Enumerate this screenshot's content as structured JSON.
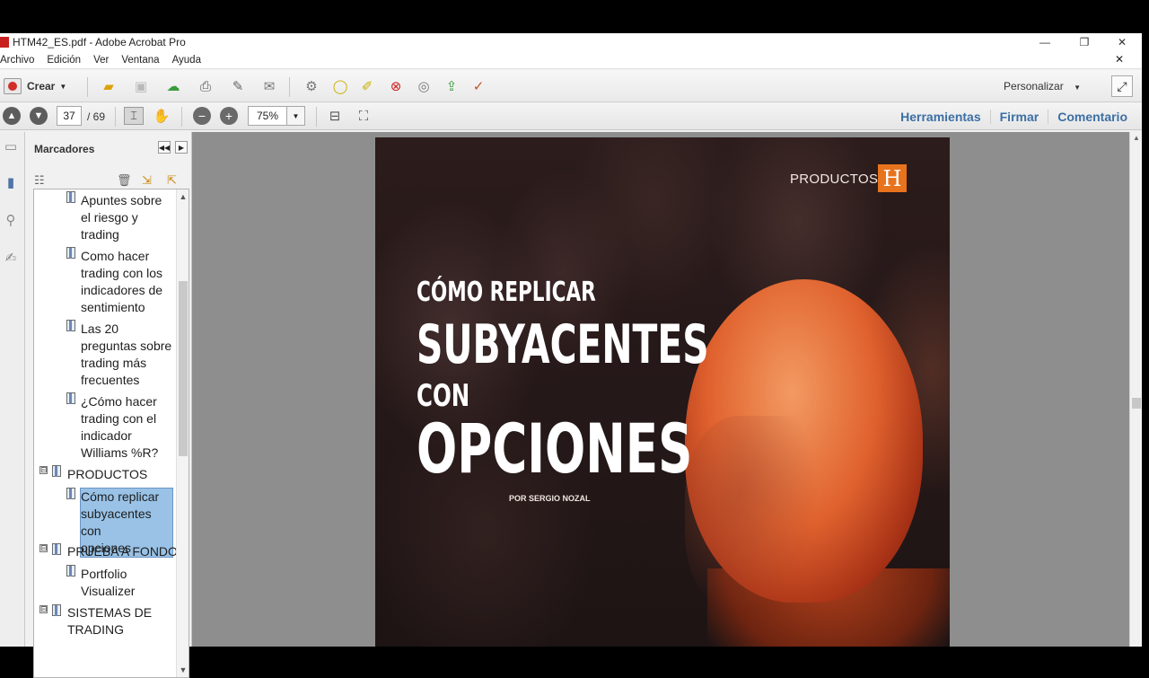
{
  "window": {
    "title": "HTM42_ES.pdf - Adobe Acrobat Pro",
    "minimize": "—",
    "restore": "❐",
    "close": "✕"
  },
  "menu": {
    "items": [
      "Archivo",
      "Edición",
      "Ver",
      "Ventana",
      "Ayuda"
    ],
    "close_doc": "✕"
  },
  "toolbar": {
    "create_label": "Crear",
    "caret": "▼",
    "customize_label": "Personalizar",
    "icons": [
      "open-folder-icon",
      "save-icon",
      "cloud-upload-icon",
      "print-icon",
      "edit-icon",
      "email-icon",
      "settings-icon",
      "comment-icon",
      "highlight-icon",
      "delete-pdf-icon",
      "security-icon",
      "export-icon",
      "form-icon"
    ],
    "expand_icon": "⤢"
  },
  "nav": {
    "prev_icon": "▲",
    "next_icon": "▼",
    "current_page": "37",
    "page_total": "/ 69",
    "zoom": "75%",
    "zoom_caret": "▼",
    "zoom_out": "−",
    "zoom_in": "+"
  },
  "tabs": [
    "Herramientas",
    "Firmar",
    "Comentario"
  ],
  "bookmarks": {
    "title": "Marcadores",
    "collapse_icon": "◀◀",
    "menu_icon": "▶",
    "items": [
      {
        "label": "Apuntes sobre el riesgo y trading",
        "lines": [
          "Apuntes sobre",
          "el riesgo y",
          "trading"
        ],
        "level": 2
      },
      {
        "label": "Como hacer trading con los indicadores de sentimiento",
        "lines": [
          "Como hacer",
          "trading con los",
          "indicadores de",
          "sentimiento"
        ],
        "level": 2
      },
      {
        "label": "Las 20 preguntas sobre trading más frecuentes",
        "lines": [
          "Las 20",
          "preguntas sobre",
          "trading más",
          "frecuentes"
        ],
        "level": 2
      },
      {
        "label": "¿Cómo hacer trading con el indicador Williams %R?",
        "lines": [
          "¿Cómo hacer",
          "trading con el",
          "indicador",
          "Williams %R?"
        ],
        "level": 2
      },
      {
        "label": "PRODUCTOS",
        "lines": [
          "PRODUCTOS"
        ],
        "level": 1
      },
      {
        "label": "Cómo replicar subyacentes con opciones",
        "lines": [
          "Cómo replicar",
          "subyacentes con",
          "opciones"
        ],
        "level": 2,
        "selected": true
      },
      {
        "label": "PRUEBA A FONDO",
        "lines": [
          "PRUEBA A FONDO"
        ],
        "level": 1
      },
      {
        "label": "Portfolio Visualizer",
        "lines": [
          "Portfolio",
          "Visualizer"
        ],
        "level": 2
      },
      {
        "label": "SISTEMAS DE TRADING",
        "lines": [
          "SISTEMAS DE",
          "TRADING"
        ],
        "level": 1
      }
    ],
    "toggle": "⊟"
  },
  "page": {
    "section_label": "PRODUCTOS",
    "logo_letter": "H",
    "title_line1": "CÓMO REPLICAR",
    "title_line2": "SUBYACENTES",
    "title_line3": "CON",
    "title_line4": "OPCIONES",
    "author": "POR SERGIO NOZAL"
  },
  "colors": {
    "accent_tab": "#3c6fa5",
    "logo_orange": "#e8731d",
    "selection": "#99c2e6"
  }
}
